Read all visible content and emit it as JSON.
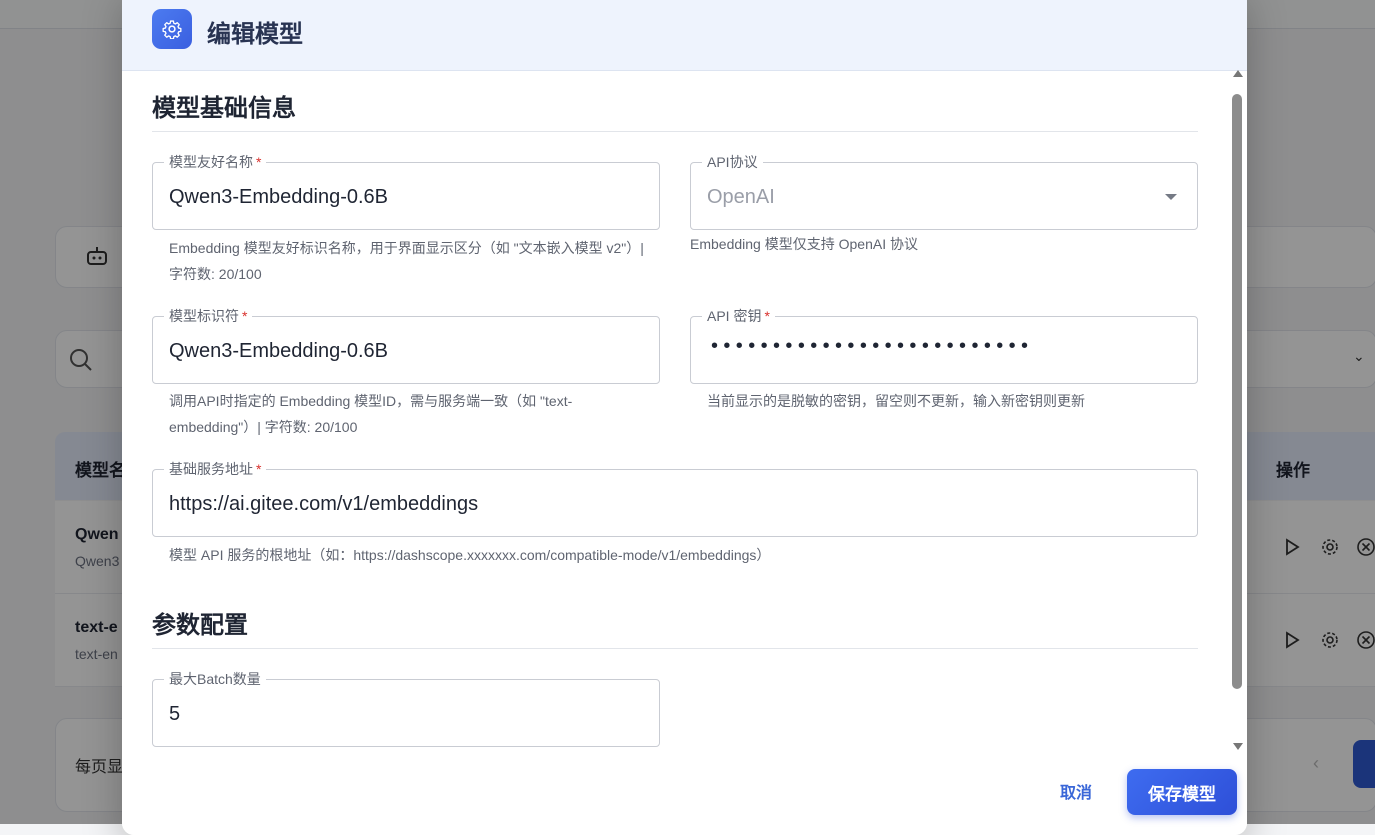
{
  "background": {
    "table_header_name": "模型名",
    "table_header_actions": "操作",
    "rows": [
      {
        "title": "Qwen",
        "subtitle": "Qwen3"
      },
      {
        "title": "text-e",
        "subtitle": "text-en"
      }
    ],
    "per_page_label": "每页显"
  },
  "dialog": {
    "title": "编辑模型",
    "sections": {
      "basic": "模型基础信息",
      "params": "参数配置"
    },
    "fields": {
      "friendly_name": {
        "label": "模型友好名称",
        "value": "Qwen3-Embedding-0.6B",
        "helper": "Embedding 模型友好标识名称，用于界面显示区分（如 \"文本嵌入模型 v2\"）| 字符数: 20/100"
      },
      "api_protocol": {
        "label": "API协议",
        "value": "OpenAI",
        "helper": "Embedding 模型仅支持 OpenAI 协议"
      },
      "model_id": {
        "label": "模型标识符",
        "value": "Qwen3-Embedding-0.6B",
        "helper": "调用API时指定的 Embedding 模型ID，需与服务端一致（如 \"text-embedding\"）| 字符数: 20/100"
      },
      "api_key": {
        "label": "API 密钥",
        "value": "••••••••••••••••••••••••••",
        "helper": "当前显示的是脱敏的密钥，留空则不更新，输入新密钥则更新"
      },
      "base_url": {
        "label": "基础服务地址",
        "value": "https://ai.gitee.com/v1/embeddings",
        "helper": "模型 API 服务的根地址（如：https://dashscope.xxxxxxx.com/compatible-mode/v1/embeddings）"
      },
      "max_batch": {
        "label": "最大Batch数量",
        "value": "5"
      }
    },
    "required_mark": "*",
    "buttons": {
      "cancel": "取消",
      "save": "保存模型"
    }
  }
}
